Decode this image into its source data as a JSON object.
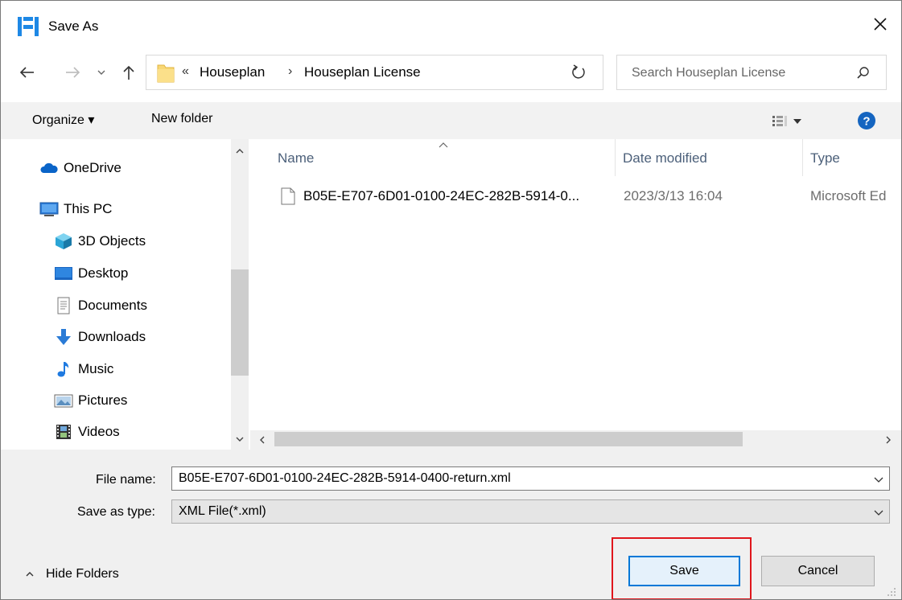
{
  "window": {
    "title": "Save As",
    "close_icon": "close-icon"
  },
  "address": {
    "overflow_chevron": "«",
    "breadcrumbs": [
      "Houseplan",
      "Houseplan License"
    ],
    "separator": "›"
  },
  "search": {
    "placeholder": "Search Houseplan License"
  },
  "toolbar": {
    "organize_label": "Organize ▾",
    "new_folder_label": "New folder"
  },
  "nav": {
    "items": [
      {
        "label": "OneDrive",
        "icon": "cloud-icon"
      },
      {
        "label": "This PC",
        "icon": "computer-icon"
      },
      {
        "label": "3D Objects",
        "icon": "cube-icon"
      },
      {
        "label": "Desktop",
        "icon": "desktop-icon"
      },
      {
        "label": "Documents",
        "icon": "documents-icon"
      },
      {
        "label": "Downloads",
        "icon": "download-icon"
      },
      {
        "label": "Music",
        "icon": "music-icon"
      },
      {
        "label": "Pictures",
        "icon": "pictures-icon"
      },
      {
        "label": "Videos",
        "icon": "videos-icon"
      }
    ]
  },
  "filelist": {
    "columns": [
      "Name",
      "Date modified",
      "Type"
    ],
    "rows": [
      {
        "name": "B05E-E707-6D01-0100-24EC-282B-5914-0...",
        "date": "2023/3/13 16:04",
        "type": "Microsoft Ed"
      }
    ]
  },
  "form": {
    "filename_label": "File name:",
    "filename_value": "B05E-E707-6D01-0100-24EC-282B-5914-0400-return.xml",
    "type_label": "Save as type:",
    "type_value": "XML File(*.xml)"
  },
  "footer": {
    "hide_folders_label": "Hide Folders",
    "save_label": "Save",
    "cancel_label": "Cancel"
  },
  "colors": {
    "accent": "#0078d7",
    "highlight": "#e0161c",
    "app_icon": "#1e88e5"
  }
}
